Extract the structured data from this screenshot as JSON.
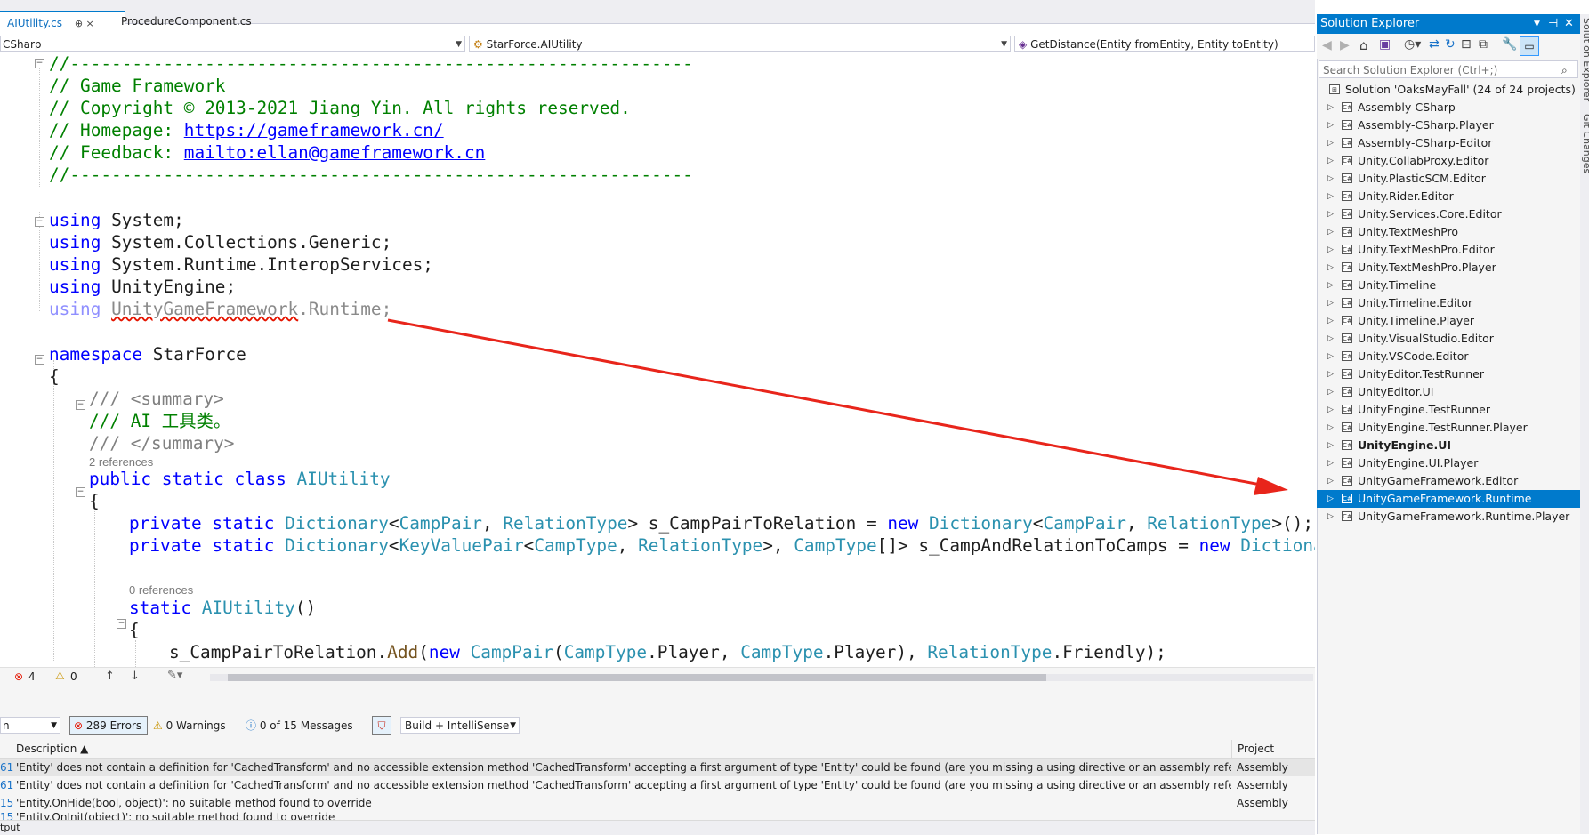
{
  "tabs": [
    {
      "label": "AIUtility.cs",
      "active": true,
      "pin": "⊕ ×"
    },
    {
      "label": "ProcedureComponent.cs",
      "active": false
    }
  ],
  "navbar": {
    "project": "CSharp",
    "class": "StarForce.AIUtility",
    "member": "GetDistance(Entity fromEntity, Entity toEntity)"
  },
  "code": {
    "header": [
      "//------------------------------------------------------------",
      "// Game Framework",
      "// Copyright © 2013-2021 Jiang Yin. All rights reserved.",
      "// Homepage: ",
      "https://gameframework.cn/",
      "// Feedback: ",
      "mailto:ellan@gameframework.cn",
      "//------------------------------------------------------------"
    ],
    "using_kw": "using",
    "usings": [
      "System;",
      "System.Collections.Generic;",
      "System.Runtime.InteropServices;",
      "UnityEngine;"
    ],
    "unused_using_ns": "UnityGameFramework",
    "unused_using_rest": ".Runtime;",
    "namespace_kw": "namespace",
    "namespace_name": "StarForce",
    "open_brace": "{",
    "summary_open": "/// <summary>",
    "summary_text": "/// AI 工具类。",
    "summary_close": "/// </summary>",
    "class_refs": "2 references",
    "class_decl_kw": "public static class",
    "class_name": "AIUtility",
    "field1": {
      "mods": "private static",
      "type": "Dictionary",
      "lt": "<",
      "arg1": "CampPair",
      "comma": ", ",
      "arg2": "RelationType",
      "gt": "> ",
      "name": "s_CampPairToRelation",
      "assign": " = ",
      "new": "new",
      "sp": " ",
      "rtype": "Dictionary",
      "rlt": "<",
      "rarg1": "CampPair",
      "rcomma": ", ",
      "rarg2": "RelationType",
      "end": ">();"
    },
    "field2": {
      "mods": "private static",
      "type": "Dictionary",
      "lt": "<",
      "kvp": "KeyValuePair",
      "lt2": "<",
      "arg1": "CampType",
      "comma": ", ",
      "arg2": "RelationType",
      "gt": ">, ",
      "arr": "CampType",
      "arrend": "[]> ",
      "name": "s_CampAndRelationToCamps",
      "assign": " = ",
      "new": "new",
      "sp": " ",
      "rtype": "Dictionary"
    },
    "ctor_refs": "0 references",
    "ctor_kw": "static",
    "ctor_name": "AIUtility",
    "ctor_parens": "()",
    "last_line": {
      "a": "s_CampPairToRelation.",
      "b": "Add",
      "c": "(",
      "d": "new",
      "e": " ",
      "f": "CampPair",
      "g": "(",
      "h": "CampType",
      "i": ".Player, ",
      "j": "CampType",
      "k": ".Player), ",
      "l": "RelationType",
      "m": ".Friendly);"
    }
  },
  "editor_status": {
    "errors": "4",
    "warnings": "0"
  },
  "error_list": {
    "scope": "n",
    "errors_btn": "289 Errors",
    "warnings_btn": "0 Warnings",
    "messages_btn": "0 of 15 Messages",
    "build_filter": "Build + IntelliSense",
    "col_description": "Description",
    "col_project": "Project",
    "rows": [
      {
        "code": "61",
        "desc": "'Entity' does not contain a definition for 'CachedTransform' and no accessible extension method 'CachedTransform' accepting a first argument of type 'Entity' could be found (are you missing a using directive or an assembly reference?)",
        "project": "Assembly"
      },
      {
        "code": "61",
        "desc": "'Entity' does not contain a definition for 'CachedTransform' and no accessible extension method 'CachedTransform' accepting a first argument of type 'Entity' could be found (are you missing a using directive or an assembly reference?)",
        "project": "Assembly"
      },
      {
        "code": "15",
        "desc": "'Entity.OnHide(bool, object)': no suitable method found to override",
        "project": "Assembly"
      },
      {
        "code": "15",
        "desc": "'Entity.OnInit(object)': no suitable method found to override",
        "project": ""
      }
    ],
    "output_tab": "tput"
  },
  "solution_explorer": {
    "title": "Solution Explorer",
    "search_placeholder": "Search Solution Explorer (Ctrl+;)",
    "solution": "Solution 'OaksMayFall' (24 of 24 projects)",
    "projects": [
      "Assembly-CSharp",
      "Assembly-CSharp.Player",
      "Assembly-CSharp-Editor",
      "Unity.CollabProxy.Editor",
      "Unity.PlasticSCM.Editor",
      "Unity.Rider.Editor",
      "Unity.Services.Core.Editor",
      "Unity.TextMeshPro",
      "Unity.TextMeshPro.Editor",
      "Unity.TextMeshPro.Player",
      "Unity.Timeline",
      "Unity.Timeline.Editor",
      "Unity.Timeline.Player",
      "Unity.VisualStudio.Editor",
      "Unity.VSCode.Editor",
      "UnityEditor.TestRunner",
      "UnityEditor.UI",
      "UnityEngine.TestRunner",
      "UnityEngine.TestRunner.Player",
      "UnityEngine.UI",
      "UnityEngine.UI.Player",
      "UnityGameFramework.Editor",
      "UnityGameFramework.Runtime",
      "UnityGameFramework.Runtime.Player"
    ],
    "bold_item": "UnityEngine.UI",
    "selected_item": "UnityGameFramework.Runtime"
  },
  "side_tabs": [
    "Solution Explorer",
    "Git Changes"
  ],
  "colors": {
    "accent": "#007acc",
    "arrow": "#e8251b",
    "comment": "#008000",
    "keyword": "#0000ff",
    "type": "#2b91af"
  }
}
